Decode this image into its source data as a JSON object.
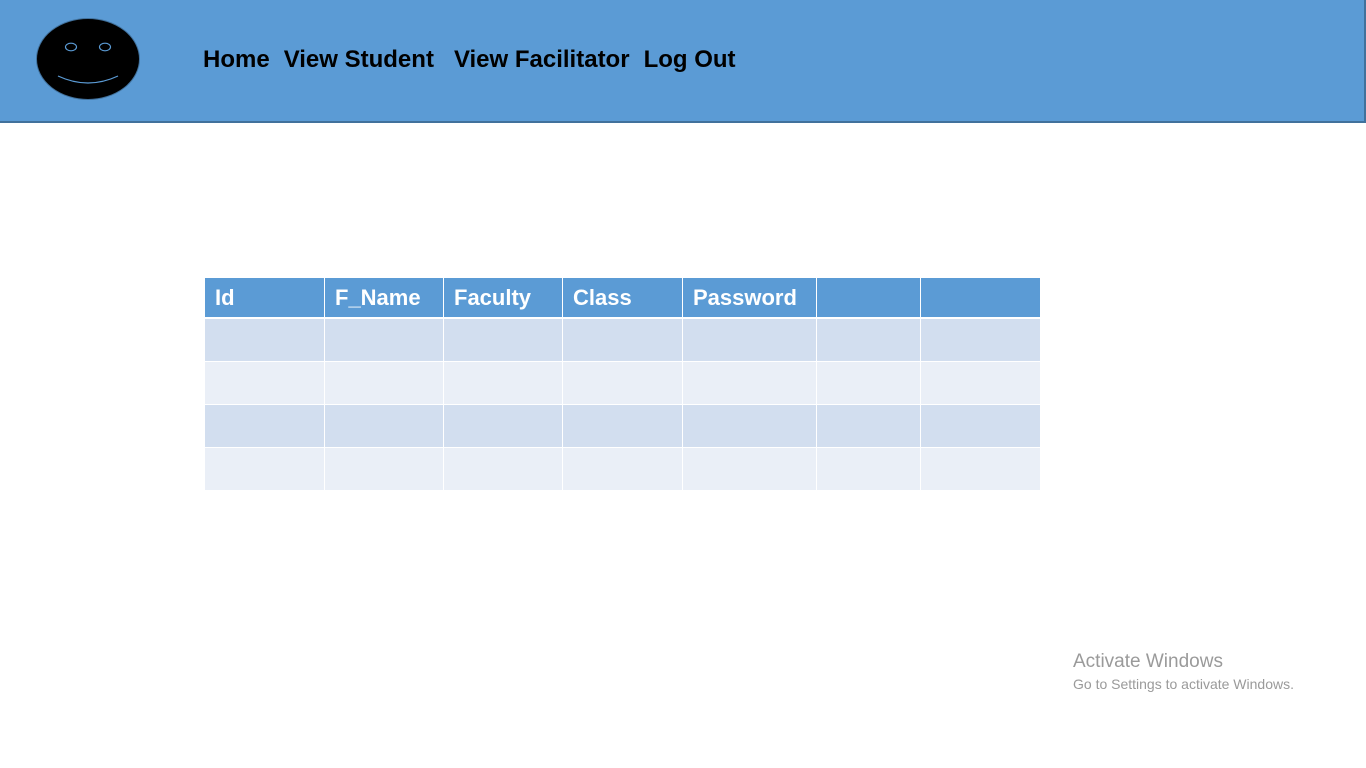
{
  "header": {
    "logo_icon": "smiley-face-icon",
    "background_color": "#5b9bd5",
    "nav": {
      "home": "Home",
      "view_student": "View Student",
      "view_facilitator": "View Facilitator",
      "log_out": "Log Out"
    }
  },
  "table": {
    "header_color": "#5b9bd5",
    "row_colors": [
      "#d2deef",
      "#eaeff7"
    ],
    "columns": [
      "Id",
      "F_Name",
      "Faculty",
      "Class",
      "Password",
      "",
      ""
    ],
    "rows": [
      [
        "",
        "",
        "",
        "",
        "",
        "",
        ""
      ],
      [
        "",
        "",
        "",
        "",
        "",
        "",
        ""
      ],
      [
        "",
        "",
        "",
        "",
        "",
        "",
        ""
      ],
      [
        "",
        "",
        "",
        "",
        "",
        "",
        ""
      ]
    ]
  },
  "watermark": {
    "title": "Activate Windows",
    "subtitle": "Go to Settings to activate Windows."
  }
}
